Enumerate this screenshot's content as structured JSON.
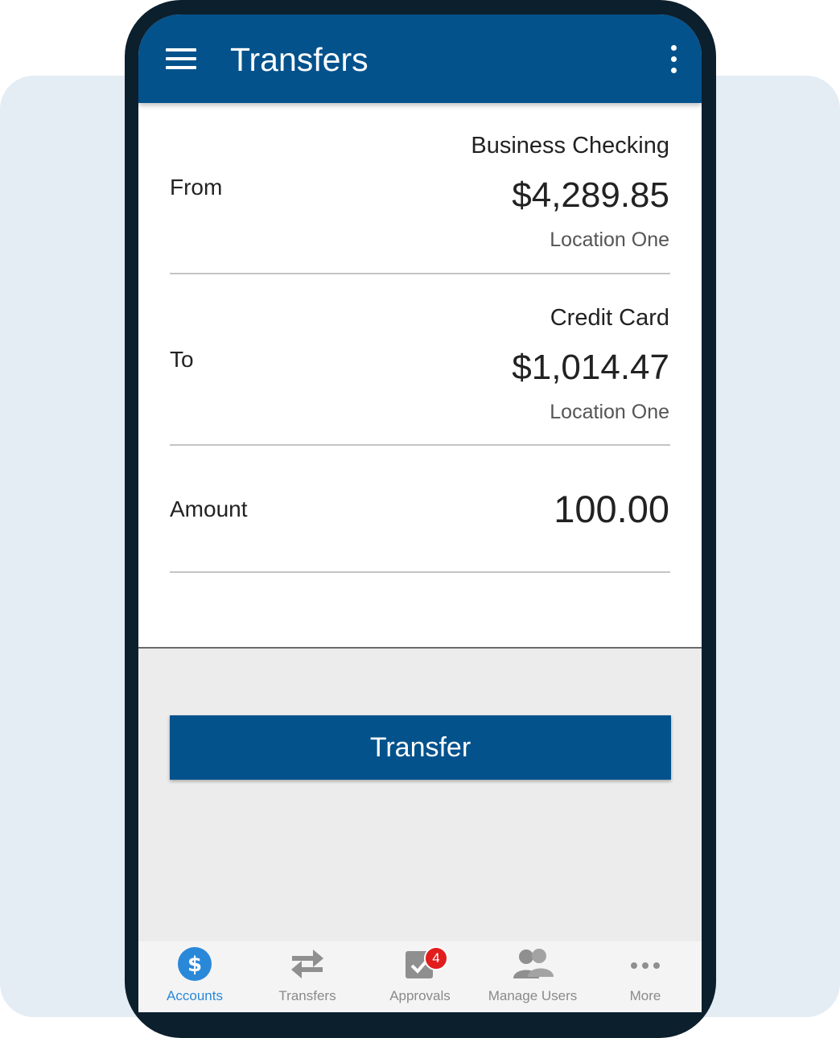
{
  "header": {
    "title": "Transfers"
  },
  "from": {
    "label": "From",
    "account_name": "Business Checking",
    "balance": "$4,289.85",
    "location": "Location One"
  },
  "to": {
    "label": "To",
    "account_name": "Credit Card",
    "balance": "$1,014.47",
    "location": "Location One"
  },
  "amount": {
    "label": "Amount",
    "value": "100.00"
  },
  "action": {
    "transfer_label": "Transfer"
  },
  "nav": {
    "items": [
      {
        "label": "Accounts",
        "icon": "dollar-circle-icon",
        "active": true
      },
      {
        "label": "Transfers",
        "icon": "swap-arrows-icon"
      },
      {
        "label": "Approvals",
        "icon": "approval-check-icon",
        "badge": "4"
      },
      {
        "label": "Manage Users",
        "icon": "users-icon"
      },
      {
        "label": "More",
        "icon": "more-dots-icon"
      }
    ]
  },
  "colors": {
    "primary": "#03528c",
    "active_nav": "#2a88d8",
    "badge": "#e11d1d",
    "frame": "#0c1f2d",
    "backdrop": "#e4ecf4"
  }
}
